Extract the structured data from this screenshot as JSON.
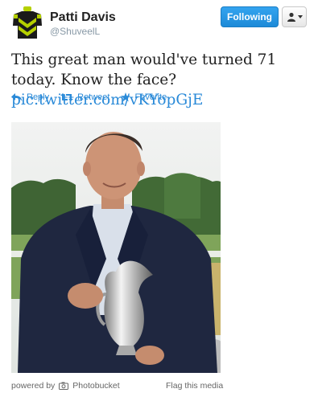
{
  "user": {
    "name": "Patti Davis",
    "handle": "@ShuveelL"
  },
  "header": {
    "follow_label": "Following"
  },
  "tweet": {
    "text": "This great man would've turned 71 today. Know the face?",
    "link": "pic.twitter.com/vKYopGjE"
  },
  "actions": {
    "reply": "Reply",
    "retweet": "Retweet",
    "favorite": "Favorite"
  },
  "media": {
    "powered_by": "powered by",
    "provider": "Photobucket",
    "flag": "Flag this media"
  },
  "colors": {
    "accent": "#2a8ad8",
    "follow_button": "#1d8ad8"
  },
  "icons": [
    "jockey-silks-avatar",
    "user-icon",
    "reply-icon",
    "retweet-icon",
    "star-icon",
    "camera-icon"
  ]
}
